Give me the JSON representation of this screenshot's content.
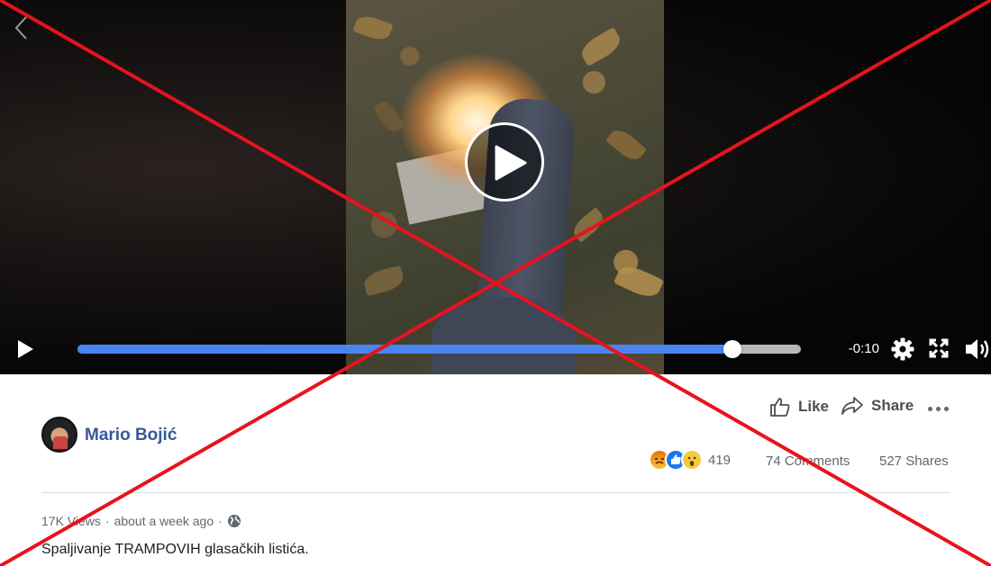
{
  "player": {
    "time_remaining": "-0:10",
    "progress": 0.905,
    "accent_color": "#4a84f0",
    "icons": [
      "back-chevron-icon",
      "play-icon",
      "gear-icon",
      "fullscreen-icon",
      "volume-icon"
    ]
  },
  "post": {
    "author": "Mario Bojić",
    "actions": {
      "like_label": "Like",
      "share_label": "Share"
    },
    "reactions": {
      "types": [
        "angry",
        "like",
        "wow"
      ],
      "count": "419"
    },
    "comments": "74 Comments",
    "shares": "527 Shares",
    "meta": {
      "views": "17K Views",
      "separator": "·",
      "time": "about a week ago"
    },
    "caption": "Spaljivanje TRAMPOVIH glasačkih listića."
  },
  "overlay": {
    "cross_color": "#e8121f"
  }
}
